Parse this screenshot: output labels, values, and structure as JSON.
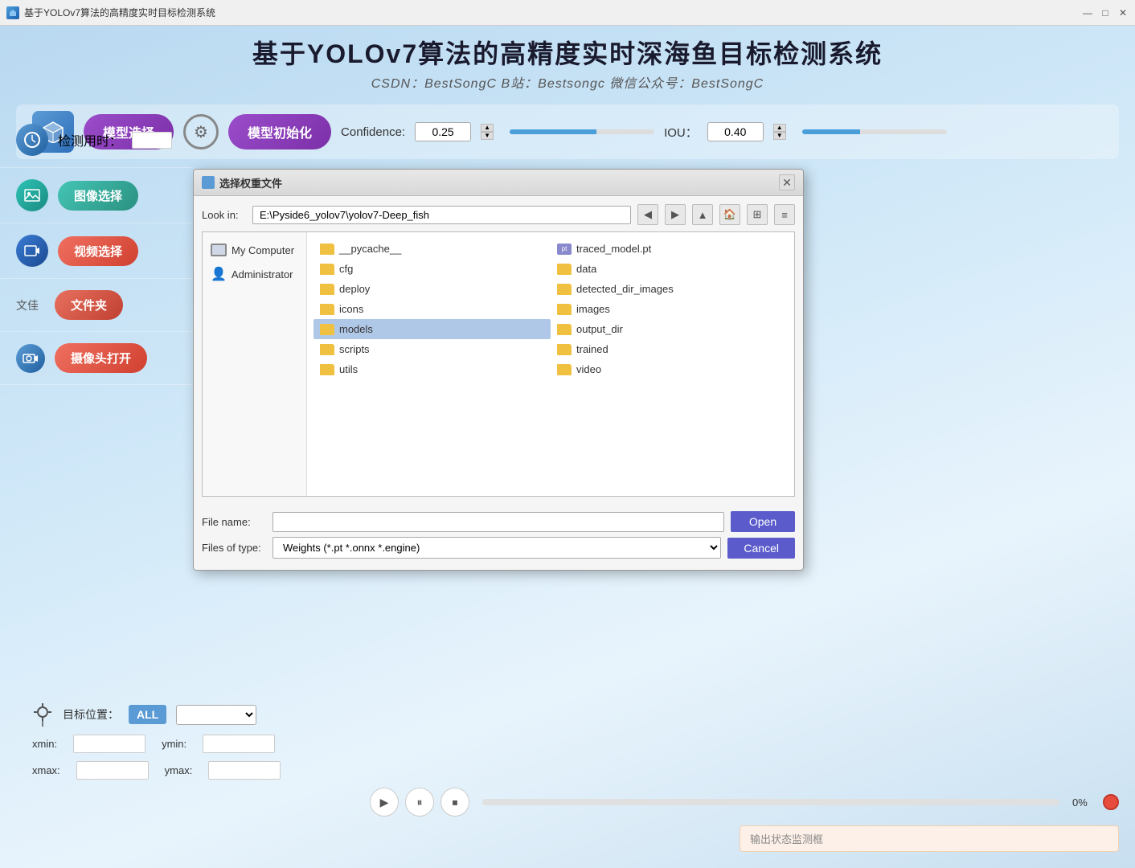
{
  "titleBar": {
    "icon": "app-icon",
    "title": "基于YOLOv7算法的高精度实时目标检测系统",
    "minBtn": "—",
    "maxBtn": "□",
    "closeBtn": "✕"
  },
  "appTitle": {
    "main": "基于YOLOv7算法的高精度实时深海鱼目标检测系统",
    "sub": "CSDN：BestSongC   B站：Bestsongc   微信公众号：BestSongC"
  },
  "toolbar": {
    "modelSelectBtn": "模型选择",
    "modelInitBtn": "模型初始化",
    "confidenceLabel": "Confidence:",
    "confidenceValue": "0.25",
    "iouLabel": "IOU：",
    "iouValue": "0.40"
  },
  "sidebar": {
    "detectTimeLabel": "检测用时：",
    "imageSelectBtn": "图像选择",
    "videoSelectBtn": "视频选择",
    "fileFolderLabel": "文佳",
    "folderBtn": "文件夹",
    "cameraBtn": "摄像头打开"
  },
  "bottomControls": {
    "targetLabel": "目标位置：",
    "allBtn": "ALL",
    "xminLabel": "xmin:",
    "yminLabel": "ymin:",
    "xmaxLabel": "xmax:",
    "ymaxLabel": "ymax:",
    "progressPercent": "0%",
    "outputPlaceholder": "输出状态监测框"
  },
  "dialog": {
    "titleIconColor": "#5b9bd5",
    "title": "选择权重文件",
    "closeBtn": "✕",
    "lookInLabel": "Look in:",
    "lookInPath": "E:\\Pyside6_yolov7\\yolov7-Deep_fish",
    "sidebarItems": [
      {
        "id": "my-computer",
        "label": "My Computer",
        "type": "pc"
      },
      {
        "id": "administrator",
        "label": "Administrator",
        "type": "user"
      }
    ],
    "files": [
      {
        "name": "__pycache__",
        "type": "folder"
      },
      {
        "name": "traced_model.pt",
        "type": "pt"
      },
      {
        "name": "cfg",
        "type": "folder"
      },
      {
        "name": "data",
        "type": "folder"
      },
      {
        "name": "deploy",
        "type": "folder"
      },
      {
        "name": "detected_dir_images",
        "type": "folder"
      },
      {
        "name": "icons",
        "type": "folder"
      },
      {
        "name": "images",
        "type": "folder"
      },
      {
        "name": "models",
        "type": "folder",
        "selected": true
      },
      {
        "name": "output_dir",
        "type": "folder"
      },
      {
        "name": "scripts",
        "type": "folder"
      },
      {
        "name": "trained",
        "type": "folder"
      },
      {
        "name": "utils",
        "type": "folder"
      },
      {
        "name": "video",
        "type": "folder"
      }
    ],
    "fileNameLabel": "File name:",
    "fileNameValue": "",
    "fileTypesLabel": "Files of type:",
    "fileTypesValue": "Weights (*.pt *.onnx *.engine)",
    "openBtn": "Open",
    "cancelBtn": "Cancel"
  }
}
